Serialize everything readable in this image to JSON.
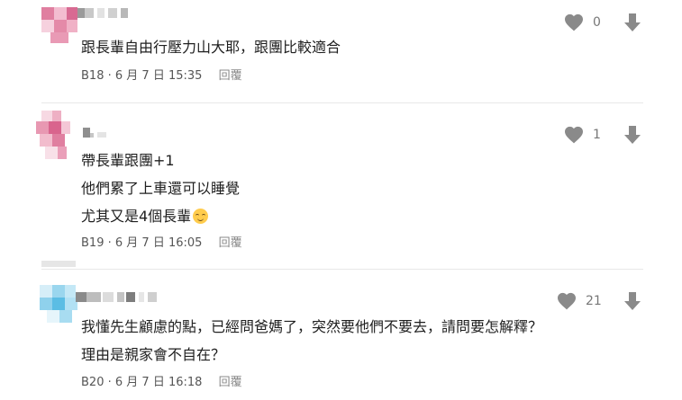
{
  "comments": [
    {
      "floor": "B18",
      "date": "6 月 7 日 15:35",
      "reply_label": "回覆",
      "likes": "0",
      "lines": [
        "跟長輩自由行壓力山大耶，跟團比較適合"
      ]
    },
    {
      "floor": "B19",
      "date": "6 月 7 日 16:05",
      "reply_label": "回覆",
      "likes": "1",
      "lines": [
        "帶長輩跟團+1",
        "他們累了上車還可以睡覺",
        "尤其又是4個長輩"
      ]
    },
    {
      "floor": "B20",
      "date": "6 月 7 日 16:18",
      "reply_label": "回覆",
      "likes": "21",
      "lines": [
        "我懂先生顧慮的點，已經問爸媽了，突然要他們不要去，請問要怎解釋？",
        "理由是親家會不自在？"
      ]
    }
  ],
  "colors": {
    "icon": "#8a8a8a",
    "divider": "#e8e8e8",
    "avatar_pink": "#e48aa8",
    "avatar_blue": "#6cc4e6"
  },
  "icons": {
    "like": "heart-icon",
    "dislike": "arrow-down-icon",
    "emoji": "relieved-face-emoji"
  }
}
